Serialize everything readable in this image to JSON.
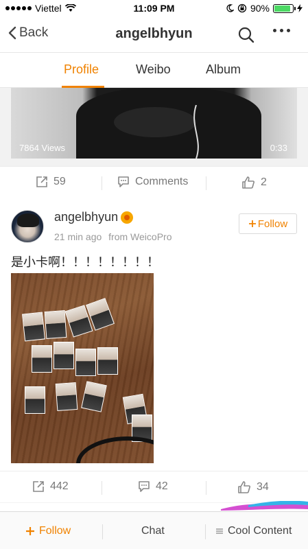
{
  "status_bar": {
    "carrier": "Viettel",
    "time": "11:09 PM",
    "battery": "90%",
    "battery_level": 0.9
  },
  "nav": {
    "back_label": "Back",
    "title": "angelbhyun"
  },
  "tabs": [
    {
      "label": "Profile",
      "active": true
    },
    {
      "label": "Weibo",
      "active": false
    },
    {
      "label": "Album",
      "active": false
    }
  ],
  "video_post": {
    "views": "7864 Views",
    "duration": "0:33",
    "reposts": "59",
    "comments": "Comments",
    "likes": "2"
  },
  "post": {
    "username": "angelbhyun",
    "time": "21 min ago",
    "source": "from WeicoPro",
    "follow_label": "Follow",
    "text": "是小卡啊！！！！！！！！",
    "reposts": "442",
    "comments": "42",
    "likes": "34"
  },
  "bottom_bar": {
    "follow": "Follow",
    "chat": "Chat",
    "cool_content": "Cool Content"
  },
  "colors": {
    "accent": "#f08200",
    "text": "#333333",
    "muted": "#999999"
  }
}
